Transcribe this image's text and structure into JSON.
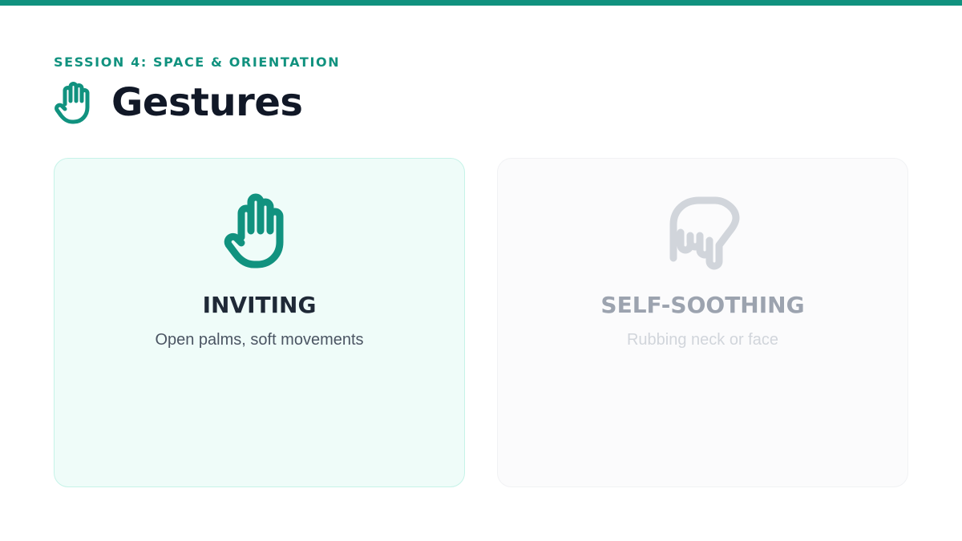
{
  "session_label": "SESSION 4: SPACE & ORIENTATION",
  "title": "Gestures",
  "title_icon": "open-hand-icon",
  "colors": {
    "accent": "#11927f",
    "card_active_bg": "#effcf9",
    "card_inactive_bg": "#fbfbfc",
    "inactive_icon": "#d1d5db"
  },
  "cards": [
    {
      "icon": "open-hand-icon",
      "title": "INVITING",
      "description": "Open palms, soft movements",
      "state": "active"
    },
    {
      "icon": "hand-pointing-down-icon",
      "title": "SELF-SOOTHING",
      "description": "Rubbing neck or face",
      "state": "inactive"
    }
  ]
}
